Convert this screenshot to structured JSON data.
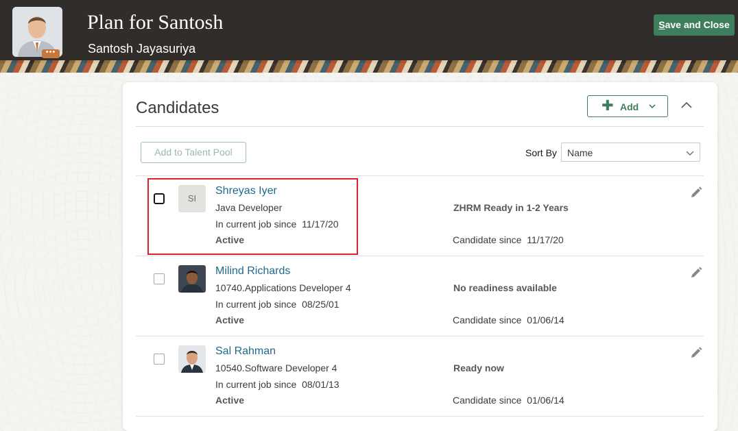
{
  "header": {
    "title": "Plan for Santosh",
    "subtitle": "Santosh Jayasuriya",
    "avatar_icon": "person-photo",
    "more_icon": "more-dots-icon",
    "save_close_accel": "S",
    "save_close_rest": "ave and Close",
    "background_color": "#312d2a"
  },
  "candidates_panel": {
    "title": "Candidates",
    "add_label": "Add",
    "add_to_talent_pool_label": "Add to Talent Pool",
    "sort_by_label": "Sort By",
    "sort_by_value": "Name",
    "accent_color": "#3e7e5c",
    "link_color": "#1f6a8a",
    "rows": [
      {
        "initials": "SI",
        "name": "Shreyas Iyer",
        "job": "Java Developer",
        "in_job_since_label": "In current job since",
        "in_job_since": "11/17/20",
        "status": "Active",
        "readiness": "ZHRM Ready in 1-2 Years",
        "candidate_since_label": "Candidate since",
        "candidate_since": "11/17/20"
      },
      {
        "initials": "",
        "name": "Milind Richards",
        "job": "10740.Applications Developer 4",
        "in_job_since_label": "In current job since",
        "in_job_since": "08/25/01",
        "status": "Active",
        "readiness": "No readiness available",
        "candidate_since_label": "Candidate since",
        "candidate_since": "01/06/14"
      },
      {
        "initials": "",
        "name": "Sal Rahman",
        "job": "10540.Software Developer 4",
        "in_job_since_label": "In current job since",
        "in_job_since": "08/01/13",
        "status": "Active",
        "readiness": "Ready now",
        "candidate_since_label": "Candidate since",
        "candidate_since": "01/06/14"
      }
    ]
  }
}
